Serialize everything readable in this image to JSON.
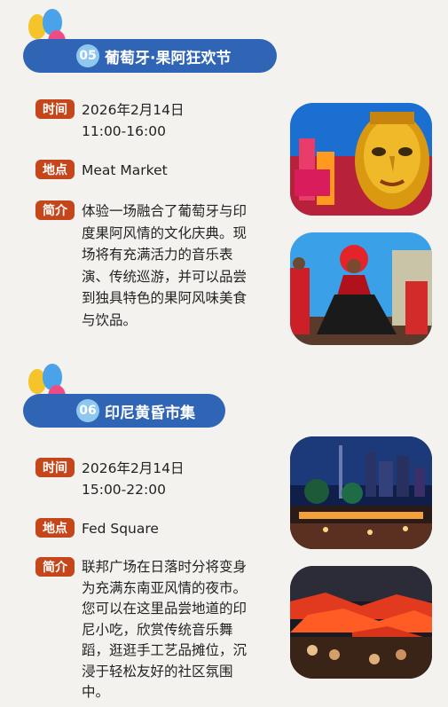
{
  "events": [
    {
      "number": "05",
      "title": "葡萄牙·果阿狂欢节",
      "time_label": "时间",
      "time_line1": "2026年2月14日",
      "time_line2": "11:00-16:00",
      "place_label": "地点",
      "place": "Meat Market",
      "intro_label": "简介",
      "intro_lines": [
        "体验一场融合了葡萄牙与印",
        "度果阿风情的文化庆典。现",
        "场将有充满活力的音乐表",
        "演、传统巡游，并可以品尝",
        "到独具特色的果阿风味美食",
        "与饮品。"
      ],
      "photos": [
        "golden-mask-photo",
        "dancers-photo"
      ]
    },
    {
      "number": "06",
      "title": "印尼黄昏市集",
      "time_label": "时间",
      "time_line1": "2026年2月14日",
      "time_line2": "15:00-22:00",
      "place_label": "地点",
      "place": "Fed Square",
      "intro_label": "简介",
      "intro_lines": [
        "联邦广场在日落时分将变身",
        "为充满东南亚风情的夜市。",
        "您可以在这里品尝地道的印",
        "尼小吃，欣赏传统音乐舞",
        "蹈，逛逛手工艺品摊位，沉",
        "浸于轻松友好的社区氛围",
        "中。"
      ],
      "photos": [
        "night-city-market-photo",
        "night-market-stalls-photo"
      ]
    }
  ],
  "colors": {
    "background": "#f3f2ef",
    "pill": "#2f65b4",
    "number_circle": "#8fc8ee",
    "tag": "#c6461b"
  }
}
